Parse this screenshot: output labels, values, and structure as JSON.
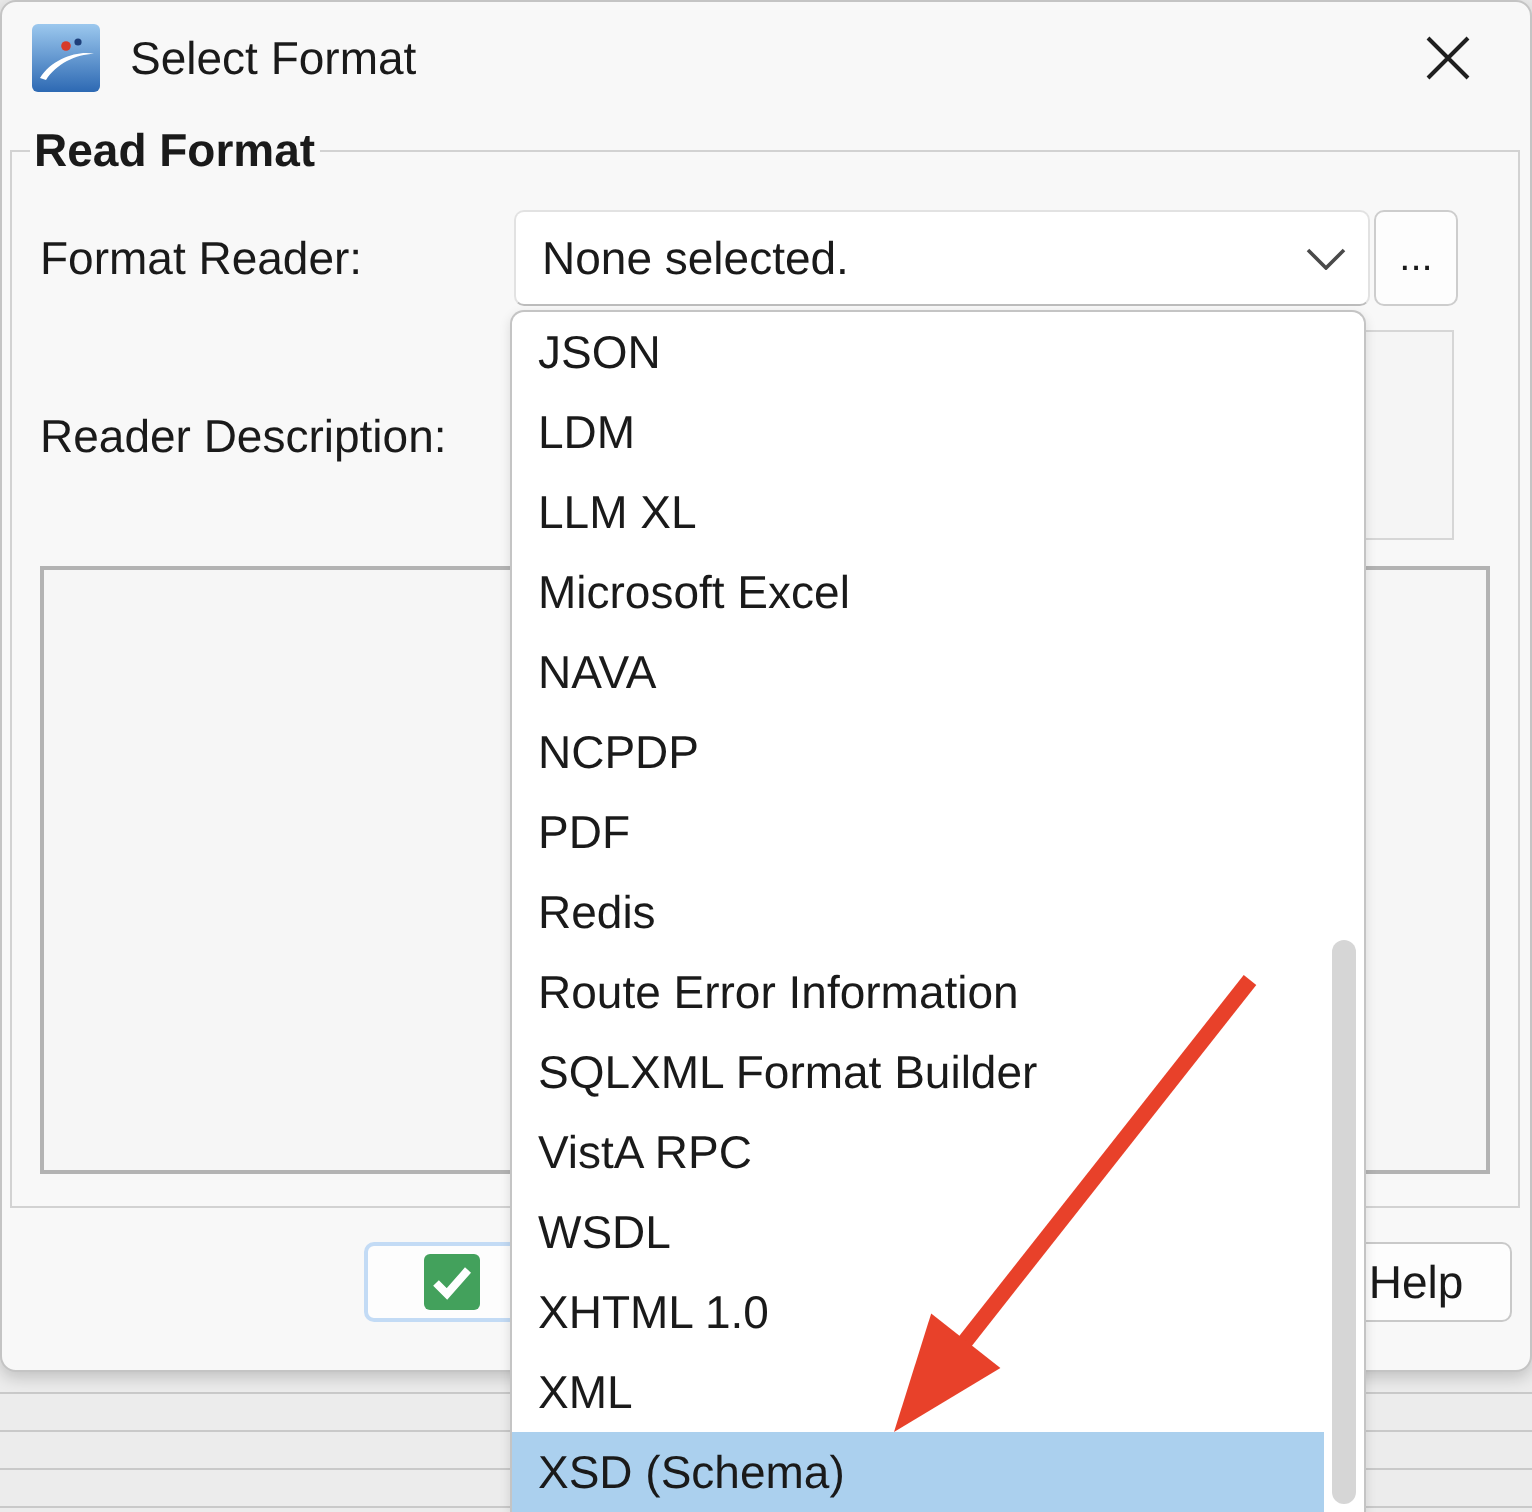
{
  "window": {
    "title": "Select Format"
  },
  "group": {
    "title": "Read Format",
    "format_reader": {
      "label": "Format Reader:",
      "value": "None selected.",
      "browse_button": "...",
      "options": [
        {
          "label": "JSON",
          "selected": false
        },
        {
          "label": "LDM",
          "selected": false
        },
        {
          "label": "LLM XL",
          "selected": false
        },
        {
          "label": "Microsoft Excel",
          "selected": false
        },
        {
          "label": "NAVA",
          "selected": false
        },
        {
          "label": "NCPDP",
          "selected": false
        },
        {
          "label": "PDF",
          "selected": false
        },
        {
          "label": "Redis",
          "selected": false
        },
        {
          "label": "Route Error Information",
          "selected": false
        },
        {
          "label": "SQLXML Format Builder",
          "selected": false
        },
        {
          "label": "VistA RPC",
          "selected": false
        },
        {
          "label": "WSDL",
          "selected": false
        },
        {
          "label": "XHTML 1.0",
          "selected": false
        },
        {
          "label": "XML",
          "selected": false
        },
        {
          "label": "XSD (Schema)",
          "selected": true
        }
      ]
    },
    "reader_description": {
      "label": "Reader Description:"
    }
  },
  "buttons": [
    {
      "kind": "accept",
      "focused": true
    },
    {
      "kind": "help",
      "label": "Help",
      "focused": false
    }
  ]
}
